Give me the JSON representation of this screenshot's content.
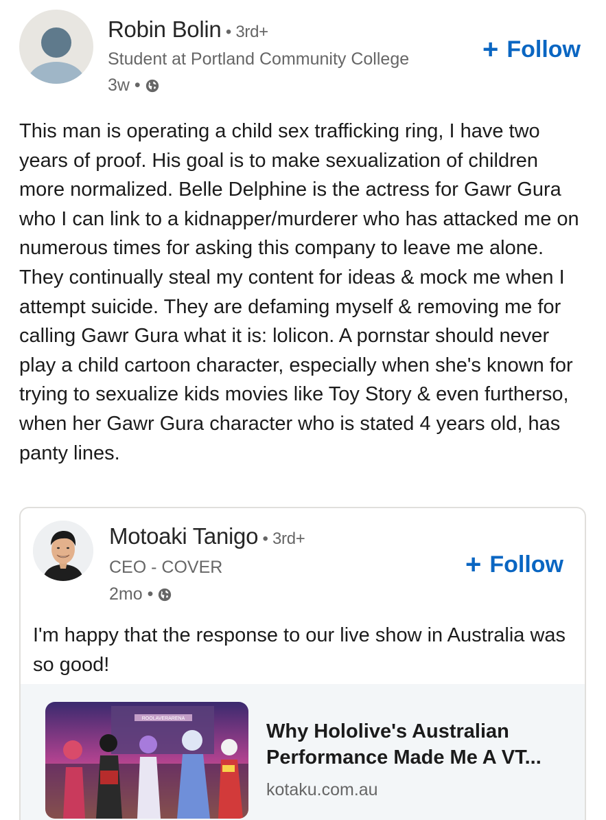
{
  "post": {
    "author_name": "Robin Bolin",
    "degree": " • 3rd+",
    "headline": "Student at Portland Community College",
    "time": "3w •",
    "follow_label": "Follow",
    "text": "This man is operating a child sex trafficking ring, I have two years of proof. His goal is to make sexualization of children more normalized. Belle Delphine is the actress for Gawr Gura who I can link to a kidnapper/murderer who has attacked me on numerous times for asking this company to leave me alone. They continually steal my content for ideas & mock me when I attempt suicide. They are defaming myself & removing me for calling Gawr Gura what it is: lolicon. A pornstar should never play a child cartoon character, especially when she's known for trying to sexualize kids movies like Toy Story & even furtherso, when her Gawr Gura character who is stated 4 years old, has panty lines."
  },
  "shared": {
    "author_name": "Motoaki Tanigo",
    "degree": " • 3rd+",
    "headline": "CEO - COVER",
    "time": "2mo •",
    "follow_label": "Follow",
    "text": "I'm happy that the response to our live show in Australia was so good!",
    "link": {
      "title": "Why Hololive's Australian Performance Made Me A VT...",
      "source": "kotaku.com.au",
      "thumb_sign": "ROOLAVERARENA"
    }
  },
  "icons": {
    "globe": "globe-icon",
    "plus": "plus-icon"
  },
  "colors": {
    "accent": "#0a66c2",
    "secondary_text": "#666666",
    "preview_bg": "#f3f6f8"
  }
}
